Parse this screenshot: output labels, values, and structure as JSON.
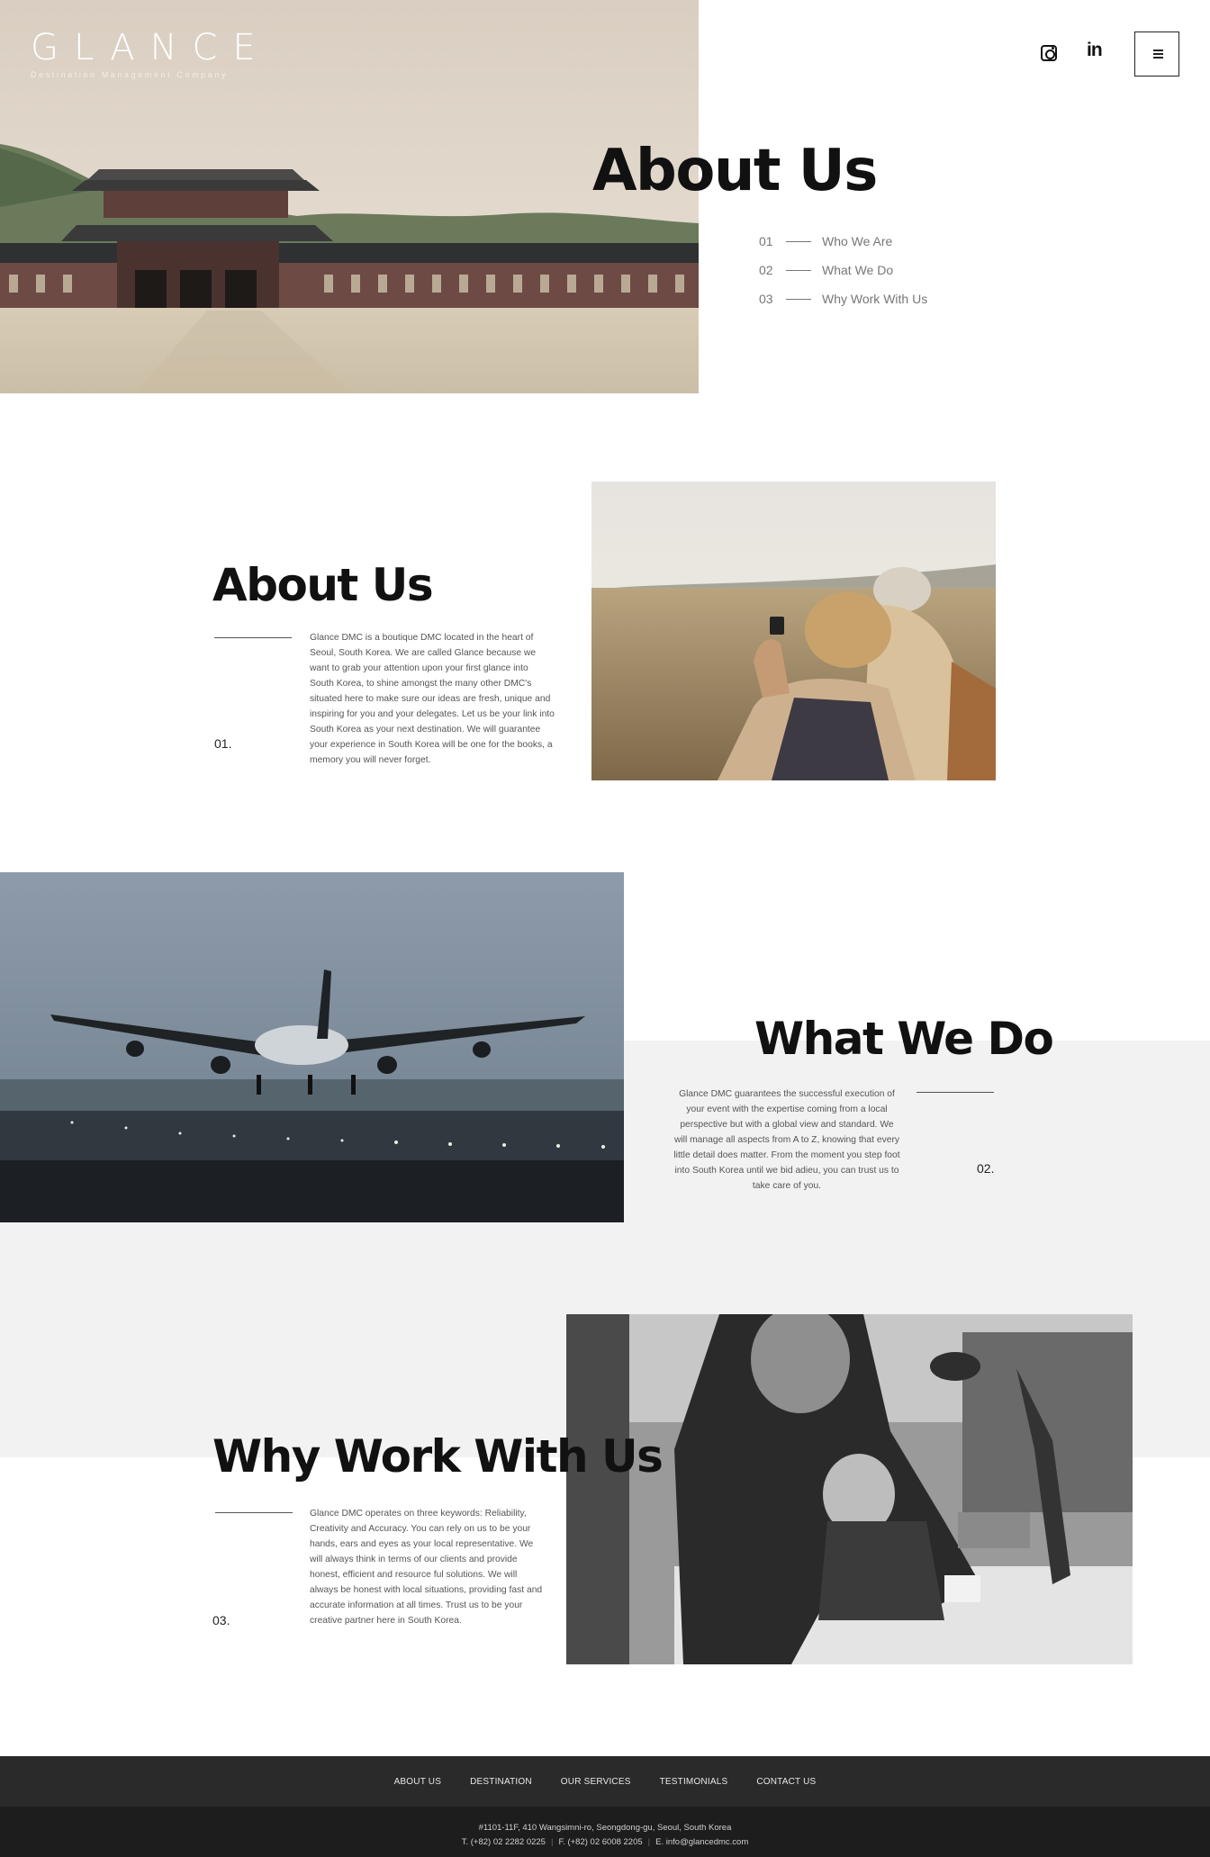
{
  "brand": {
    "logo": "GLANCE",
    "tagline": "Destination Management Company"
  },
  "header": {
    "instagram_icon": "instagram-icon",
    "linkedin_label": "in",
    "menu_icon": "hamburger-menu-icon"
  },
  "hero": {
    "title": "About Us",
    "nav": [
      {
        "num": "01",
        "label": "Who We Are"
      },
      {
        "num": "02",
        "label": "What We Do"
      },
      {
        "num": "03",
        "label": "Why Work With Us"
      }
    ]
  },
  "sections": [
    {
      "title": "About Us",
      "index": "01.",
      "body": "Glance DMC is a boutique DMC located in the heart of Seoul, South Korea. We are called Glance because we want to grab your attention upon your first glance into South Korea, to shine amongst the many other DMC's situated here to make sure our ideas are fresh, unique and inspiring for you and your delegates. Let us be your link into South Korea as your next destination. We will guarantee your experience in South Korea will be one for the books, a memory you will never forget."
    },
    {
      "title": "What We Do",
      "index": "02.",
      "body": "Glance DMC guarantees the successful execution of your event with the expertise coming from a local perspective but with a global view and standard. We will manage all aspects from A to Z, knowing that every little detail does matter. From the moment you step foot into South Korea until we bid adieu, you can trust us to take care of you."
    },
    {
      "title": "Why Work With Us",
      "index": "03.",
      "body": "Glance DMC operates on three keywords: Reliability, Creativity and Accuracy. You can rely on us to be your hands, ears and eyes as your local representative. We will always think in terms of our clients and provide honest, efficient and resource ful solutions. We will always be honest with local situations, providing fast and accurate information at all times. Trust us to be your creative partner here in South Korea."
    }
  ],
  "footer": {
    "nav": [
      "ABOUT US",
      "DESTINATION",
      "OUR SERVICES",
      "TESTIMONIALS",
      "CONTACT US"
    ],
    "address": "#1101-11F, 410 Wangsimni-ro, Seongdong-gu, Seoul, South Korea",
    "tel": "T. (+82) 02 2282 0225",
    "fax": "F. (+82) 02 6008 2205",
    "email": "E. info@glancedmc.com"
  }
}
